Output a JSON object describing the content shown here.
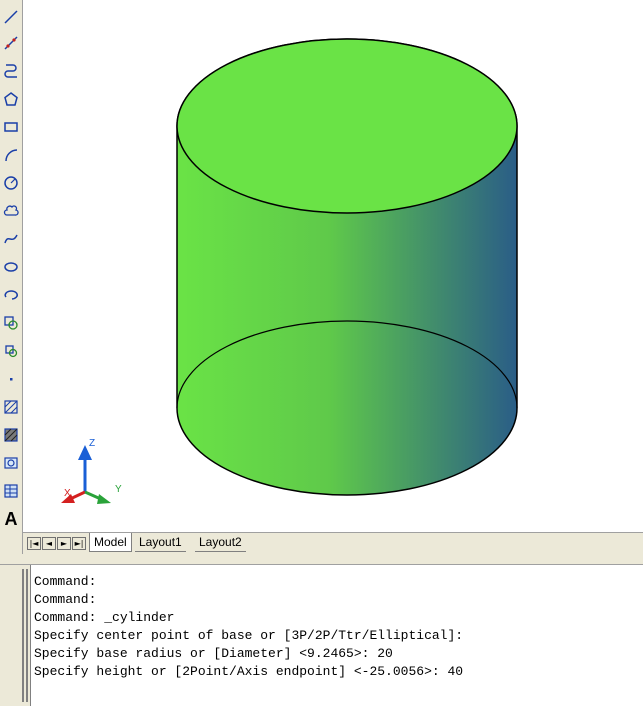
{
  "toolbar": {
    "items": [
      {
        "icon": "line-icon"
      },
      {
        "icon": "construction-line-icon"
      },
      {
        "icon": "polyline-icon"
      },
      {
        "icon": "polygon-icon"
      },
      {
        "icon": "rectangle-icon"
      },
      {
        "icon": "arc-icon"
      },
      {
        "icon": "circle-icon"
      },
      {
        "icon": "revision-cloud-icon"
      },
      {
        "icon": "spline-icon"
      },
      {
        "icon": "ellipse-icon"
      },
      {
        "icon": "ellipse-arc-icon"
      },
      {
        "icon": "insert-block-icon"
      },
      {
        "icon": "make-block-icon"
      },
      {
        "icon": "point-icon"
      },
      {
        "icon": "hatch-icon"
      },
      {
        "icon": "gradient-icon"
      },
      {
        "icon": "region-icon"
      },
      {
        "icon": "table-icon"
      },
      {
        "icon": "multiline-text-icon",
        "label": "A"
      }
    ]
  },
  "ucs": {
    "z": "Z",
    "x": "X",
    "y": "Y"
  },
  "colors": {
    "cylinder_top": "#6ae346",
    "cylinder_side_light": "#6ae346",
    "cylinder_side_dark": "#2a5d87",
    "chrome": "#ece9d8"
  },
  "tabs": {
    "nav": [
      "|◄",
      "◄",
      "►",
      "►|"
    ],
    "items": [
      {
        "label": "Model",
        "active": true
      },
      {
        "label": "Layout1",
        "active": false
      },
      {
        "label": "Layout2",
        "active": false
      }
    ]
  },
  "command": {
    "lines": [
      "Command:",
      "Command:",
      "Command: _cylinder",
      "Specify center point of base or [3P/2P/Ttr/Elliptical]:",
      "Specify base radius or [Diameter] <9.2465>: 20",
      "Specify height or [2Point/Axis endpoint] <-25.0056>: 40"
    ]
  }
}
